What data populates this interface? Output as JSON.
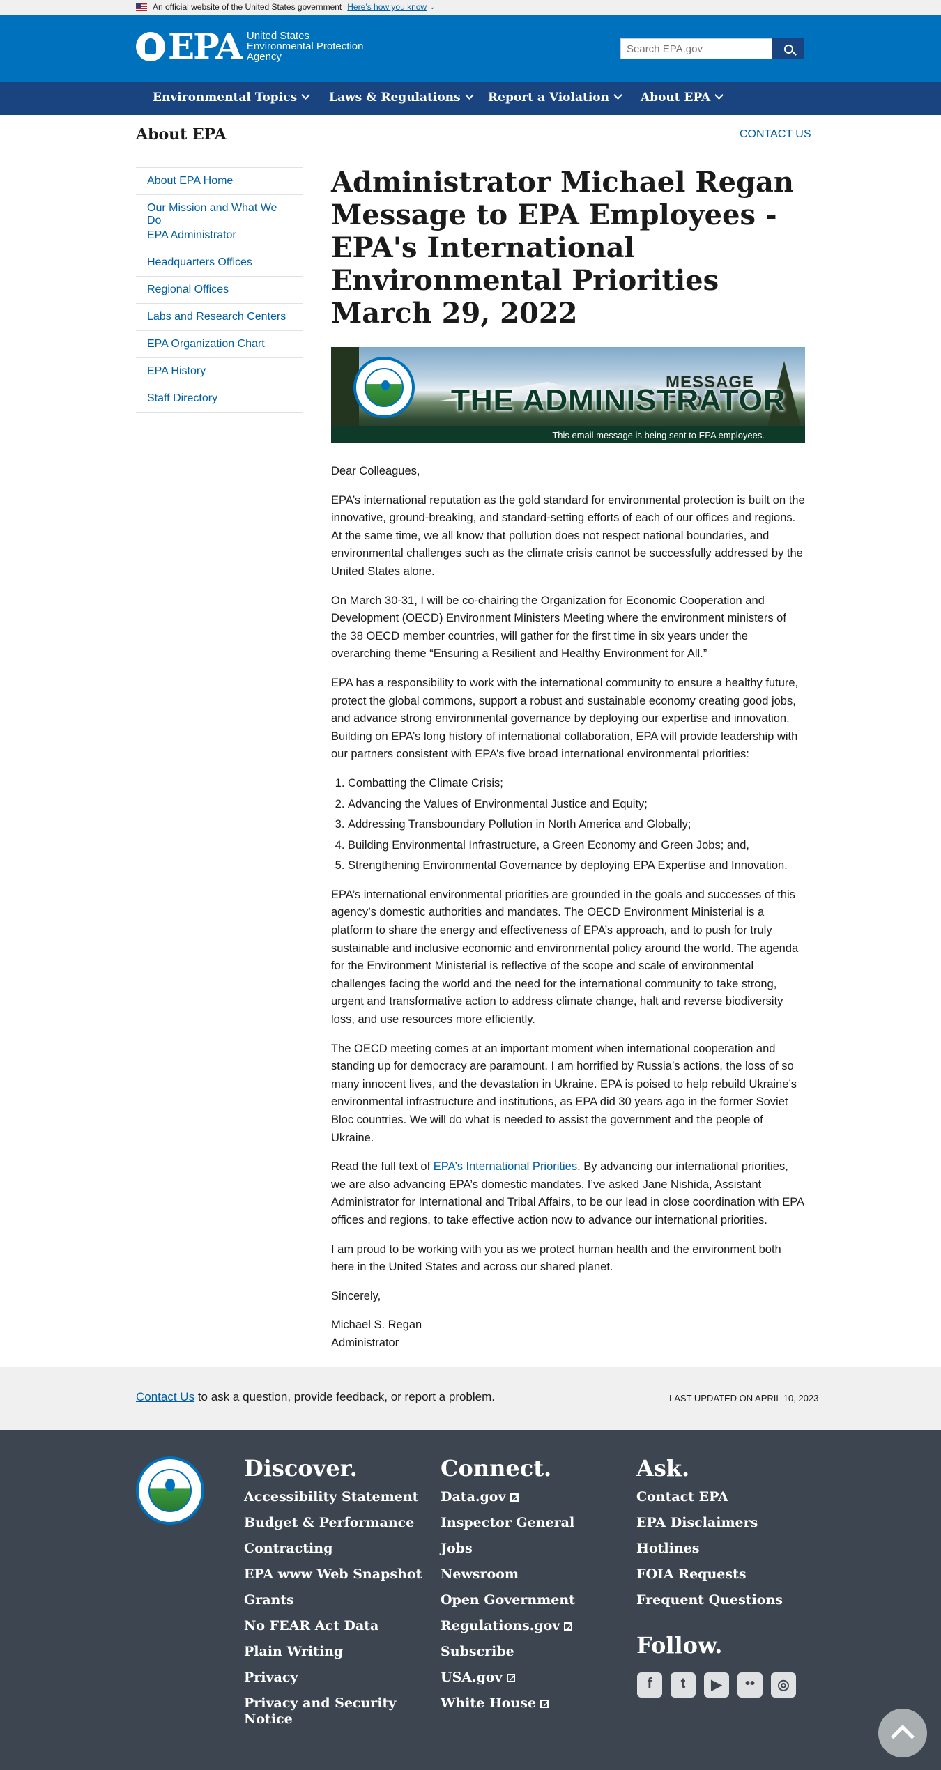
{
  "gov_banner": {
    "text": "An official website of the United States government",
    "link": "Here’s how you know"
  },
  "header": {
    "logo_text": "EPA",
    "agency_lines": [
      "United States",
      "Environmental Protection",
      "Agency"
    ],
    "search_placeholder": "Search EPA.gov"
  },
  "nav": {
    "items": [
      {
        "label": "Environmental Topics"
      },
      {
        "label": "Laws & Regulations"
      },
      {
        "label": "Report a Violation"
      },
      {
        "label": "About EPA"
      }
    ]
  },
  "section": {
    "title": "About EPA",
    "contact": "CONTACT US"
  },
  "sidebar": {
    "items": [
      {
        "label": "About EPA Home"
      },
      {
        "label": "Our Mission and What We Do"
      },
      {
        "label": "EPA Administrator"
      },
      {
        "label": "Headquarters Offices"
      },
      {
        "label": "Regional Offices"
      },
      {
        "label": "Labs and Research Centers"
      },
      {
        "label": "EPA Organization Chart"
      },
      {
        "label": "EPA History"
      },
      {
        "label": "Staff Directory"
      }
    ]
  },
  "main": {
    "title": "Administrator Michael Regan Message to EPA Employees - EPA's International Environmental Priorities March 29, 2022",
    "banner": {
      "message_from": "MESSAGE FROM",
      "heading": "THE ADMINISTRATOR",
      "note": "This email message is being sent to EPA employees.",
      "seal_text": "UNITED STATES ENVIRONMENTAL PROTECTION AGENCY"
    },
    "greeting": "Dear Colleagues,",
    "p1": "EPA’s international reputation as the gold standard for environmental protection is built on the innovative, ground-breaking, and standard-setting efforts of each of our offices and regions. At the same time, we all know that pollution does not respect national boundaries, and environmental challenges such as the climate crisis cannot be successfully addressed by the United States alone.",
    "p2": "On March 30-31, I will be co-chairing the Organization for Economic Cooperation and Development (OECD) Environment Ministers Meeting where the environment ministers of the 38 OECD member countries, will gather for the first time in six years under the overarching theme “Ensuring a Resilient and Healthy Environment for All.”",
    "p3": "EPA has a responsibility to work with the international community to ensure a healthy future, protect the global commons, support a robust and sustainable economy creating good jobs, and advance strong environmental governance by deploying our expertise and innovation. Building on EPA’s long history of international collaboration, EPA will provide leadership with our partners consistent with EPA’s five broad international environmental priorities:",
    "priorities": [
      "Combatting the Climate Crisis;",
      "Advancing the Values of Environmental Justice and Equity;",
      "Addressing Transboundary Pollution in North America and Globally;",
      "Building Environmental Infrastructure, a Green Economy and Green Jobs; and,",
      "Strengthening Environmental Governance by deploying EPA Expertise and Innovation."
    ],
    "p4": "EPA’s international environmental priorities are grounded in the goals and successes of this agency’s domestic authorities and mandates.  The OECD Environment Ministerial is a platform to share the energy and effectiveness of EPA’s approach, and to push for truly sustainable and inclusive economic and environmental policy around the world.  The agenda for the Environment Ministerial is reflective of the scope and scale of environmental challenges facing the world and the need for the international community to take strong, urgent and transformative action to address climate change, halt and reverse biodiversity loss, and use resources more efficiently.",
    "p5": "The OECD meeting comes at an important moment when international cooperation and standing up for democracy are paramount. I am horrified by Russia’s actions, the loss of so many innocent lives, and the devastation in Ukraine.  EPA is poised to help rebuild Ukraine’s environmental infrastructure and institutions, as EPA did 30 years ago in the former Soviet Bloc countries. We will do what is needed to assist the government and the people of Ukraine.",
    "p6_pre": "Read the full text of ",
    "p6_link": "EPA’s International Priorities",
    "p6_post": ". By advancing our international priorities, we are also advancing EPA’s domestic mandates.  I’ve asked Jane Nishida, Assistant Administrator for International and Tribal Affairs, to be our lead in close coordination with EPA offices and regions, to take effective action now to advance our international priorities.",
    "p7": "I am proud to be working with you as we protect human health and the environment both here in the United States and across our shared planet.",
    "closing": "Sincerely,",
    "signer_name": "Michael S. Regan",
    "signer_title": "Administrator"
  },
  "contact_strip": {
    "link": "Contact Us",
    "text": " to ask a question, provide feedback, or report a problem.",
    "updated": "LAST UPDATED ON APRIL 10, 2023"
  },
  "footer": {
    "discover": {
      "heading": "Discover.",
      "links": [
        "Accessibility Statement",
        "Budget & Performance",
        "Contracting",
        "EPA www Web Snapshot",
        "Grants",
        "No FEAR Act Data",
        "Plain Writing",
        "Privacy",
        "Privacy and Security Notice"
      ]
    },
    "connect": {
      "heading": "Connect.",
      "links": [
        "Data.gov",
        "Inspector General",
        "Jobs",
        "Newsroom",
        "Open Government",
        "Regulations.gov",
        "Subscribe",
        "USA.gov",
        "White House"
      ]
    },
    "ask": {
      "heading": "Ask.",
      "links": [
        "Contact EPA",
        "EPA Disclaimers",
        "Hotlines",
        "FOIA Requests",
        "Frequent Questions"
      ]
    },
    "follow": {
      "heading": "Follow."
    },
    "social_icons": [
      "facebook-icon",
      "twitter-icon",
      "youtube-icon",
      "flickr-icon",
      "instagram-icon"
    ]
  }
}
